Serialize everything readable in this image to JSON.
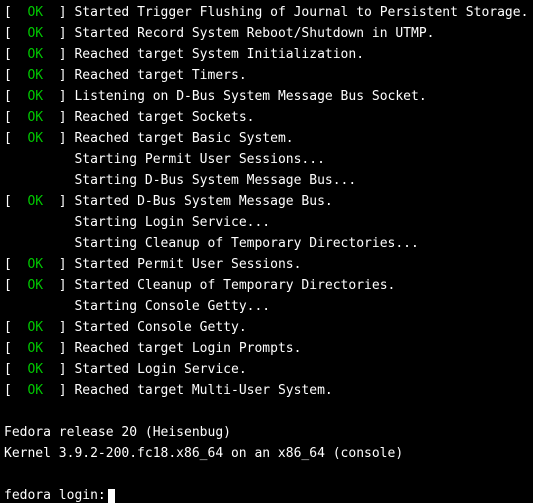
{
  "lines": [
    {
      "status": "OK",
      "indent": false,
      "text": "Started Trigger Flushing of Journal to Persistent Storage."
    },
    {
      "status": "OK",
      "indent": false,
      "text": "Started Record System Reboot/Shutdown in UTMP."
    },
    {
      "status": "OK",
      "indent": false,
      "text": "Reached target System Initialization."
    },
    {
      "status": "OK",
      "indent": false,
      "text": "Reached target Timers."
    },
    {
      "status": "OK",
      "indent": false,
      "text": "Listening on D-Bus System Message Bus Socket."
    },
    {
      "status": "OK",
      "indent": false,
      "text": "Reached target Sockets."
    },
    {
      "status": "OK",
      "indent": false,
      "text": "Reached target Basic System."
    },
    {
      "status": null,
      "indent": true,
      "text": "Starting Permit User Sessions..."
    },
    {
      "status": null,
      "indent": true,
      "text": "Starting D-Bus System Message Bus..."
    },
    {
      "status": "OK",
      "indent": false,
      "text": "Started D-Bus System Message Bus."
    },
    {
      "status": null,
      "indent": true,
      "text": "Starting Login Service..."
    },
    {
      "status": null,
      "indent": true,
      "text": "Starting Cleanup of Temporary Directories..."
    },
    {
      "status": "OK",
      "indent": false,
      "text": "Started Permit User Sessions."
    },
    {
      "status": "OK",
      "indent": false,
      "text": "Started Cleanup of Temporary Directories."
    },
    {
      "status": null,
      "indent": true,
      "text": "Starting Console Getty..."
    },
    {
      "status": "OK",
      "indent": false,
      "text": "Started Console Getty."
    },
    {
      "status": "OK",
      "indent": false,
      "text": "Reached target Login Prompts."
    },
    {
      "status": "OK",
      "indent": false,
      "text": "Started Login Service."
    },
    {
      "status": "OK",
      "indent": false,
      "text": "Reached target Multi-User System."
    }
  ],
  "banner": {
    "release": "Fedora release 20 (Heisenbug)",
    "kernel": "Kernel 3.9.2-200.fc18.x86_64 on an x86_64 (console)"
  },
  "prompt": "fedora login:",
  "status_colors": {
    "OK": "#00c800"
  }
}
